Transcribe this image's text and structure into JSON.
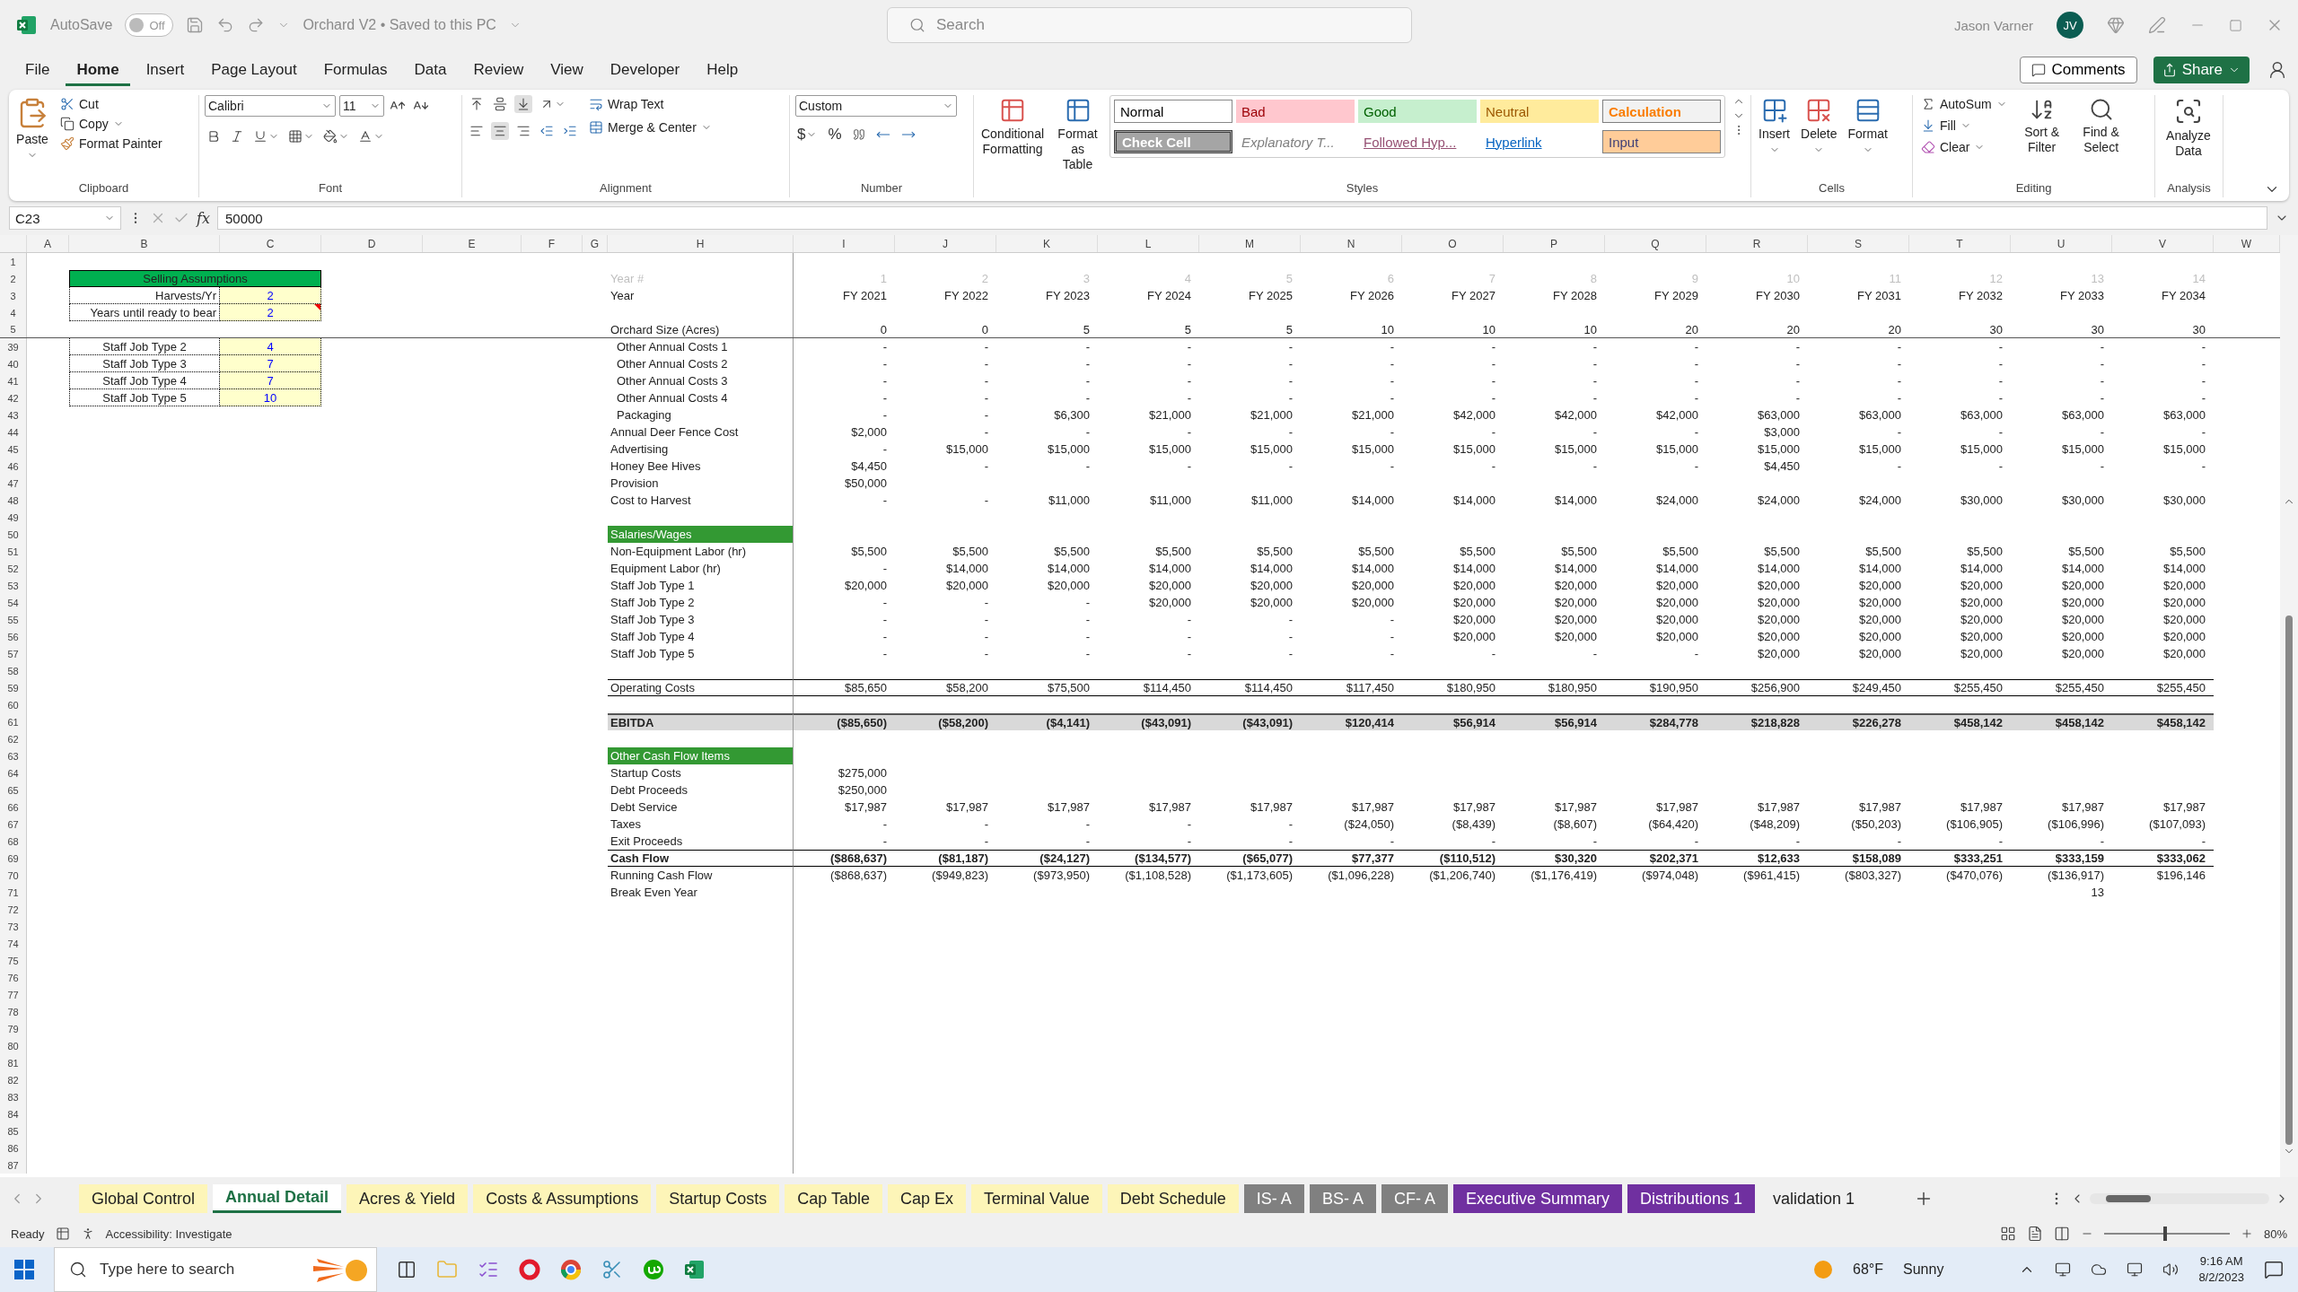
{
  "title_bar": {
    "autosave_label": "AutoSave",
    "autosave": {
      "on": false,
      "label": "Off"
    },
    "document": "Orchard V2 • Saved to this PC",
    "search_placeholder": "Search",
    "user": "Jason Varner",
    "avatar": "JV"
  },
  "menu_tabs": [
    {
      "label": "File",
      "selected": false
    },
    {
      "label": "Home",
      "selected": true
    },
    {
      "label": "Insert",
      "selected": false
    },
    {
      "label": "Page Layout",
      "selected": false
    },
    {
      "label": "Formulas",
      "selected": false
    },
    {
      "label": "Data",
      "selected": false
    },
    {
      "label": "Review",
      "selected": false
    },
    {
      "label": "View",
      "selected": false
    },
    {
      "label": "Developer",
      "selected": false
    },
    {
      "label": "Help",
      "selected": false
    }
  ],
  "comments": "Comments",
  "share": "Share",
  "ribbon": {
    "clipboard": {
      "paste": "Paste",
      "cut": "Cut",
      "copy": "Copy",
      "format_painter": "Format Painter",
      "label": "Clipboard"
    },
    "font": {
      "name": "Calibri",
      "size": "11",
      "label": "Font"
    },
    "alignment": {
      "wrap": "Wrap Text",
      "merge": "Merge & Center",
      "label": "Alignment"
    },
    "number": {
      "format": "Custom",
      "currency": "$",
      "percent": "%",
      "label": "Number"
    },
    "styles": {
      "conditional": "Conditional Formatting",
      "format_table": "Format as Table",
      "label": "Styles",
      "items": [
        {
          "label": "Normal",
          "kind": "normal"
        },
        {
          "label": "Bad",
          "kind": "bad"
        },
        {
          "label": "Good",
          "kind": "good"
        },
        {
          "label": "Neutral",
          "kind": "neutral"
        },
        {
          "label": "Calculation",
          "kind": "calculation"
        },
        {
          "label": "Check Cell",
          "kind": "check"
        },
        {
          "label": "Explanatory T...",
          "kind": "explanatory"
        },
        {
          "label": "Followed Hyp...",
          "kind": "followed"
        },
        {
          "label": "Hyperlink",
          "kind": "hyperlink"
        },
        {
          "label": "Input",
          "kind": "input"
        }
      ]
    },
    "cells": {
      "insert": "Insert",
      "delete": "Delete",
      "format": "Format",
      "label": "Cells"
    },
    "editing": {
      "autosum": "AutoSum",
      "fill": "Fill",
      "clear": "Clear",
      "sort": "Sort & Filter",
      "find": "Find & Select",
      "label": "Editing"
    },
    "analysis": {
      "analyze": "Analyze Data",
      "label": "Analysis"
    }
  },
  "formula_bar": {
    "name_box": "C23",
    "fx": "fx",
    "value": "50000"
  },
  "columns": [
    "A",
    "B",
    "C",
    "D",
    "E",
    "F",
    "G",
    "H",
    "I",
    "J",
    "K",
    "L",
    "M",
    "N",
    "O",
    "P",
    "Q",
    "R",
    "S",
    "T",
    "U",
    "V",
    "W"
  ],
  "rows": [
    {
      "n": "1",
      "kind": "plain"
    },
    {
      "n": "2",
      "kind": "year_num",
      "left": {
        "kind": "header",
        "label": "Selling Assumptions"
      },
      "h": "Year #",
      "values": [
        "1",
        "2",
        "3",
        "4",
        "5",
        "6",
        "7",
        "8",
        "9",
        "10",
        "11",
        "12",
        "13",
        "14"
      ]
    },
    {
      "n": "3",
      "kind": "plain",
      "left": {
        "kind": "setting",
        "label": "Harvests/Yr",
        "value": "2",
        "comment": false
      },
      "h": "Year",
      "values": [
        "FY 2021",
        "FY 2022",
        "FY 2023",
        "FY 2024",
        "FY 2025",
        "FY 2026",
        "FY 2027",
        "FY 2028",
        "FY 2029",
        "FY 2030",
        "FY 2031",
        "FY 2032",
        "FY 2033",
        "FY 2034"
      ]
    },
    {
      "n": "4",
      "kind": "plain",
      "left": {
        "kind": "setting",
        "label": "Years until ready to bear",
        "value": "2",
        "comment": true
      }
    },
    {
      "n": "5",
      "kind": "frozen",
      "h": "Orchard Size (Acres)",
      "values": [
        "0",
        "0",
        "5",
        "5",
        "5",
        "10",
        "10",
        "10",
        "20",
        "20",
        "20",
        "30",
        "30",
        "30"
      ]
    },
    {
      "n": "39",
      "kind": "sub",
      "left": {
        "kind": "staff",
        "label": "Staff Job Type 2",
        "value": "4",
        "comment": false
      },
      "h": "Other Annual Costs 1",
      "values": [
        "-",
        "-",
        "-",
        "-",
        "-",
        "-",
        "-",
        "-",
        "-",
        "-",
        "-",
        "-",
        "-",
        "-"
      ]
    },
    {
      "n": "40",
      "kind": "sub",
      "left": {
        "kind": "staff",
        "label": "Staff Job Type 3",
        "value": "7",
        "comment": false
      },
      "h": "Other Annual Costs 2",
      "values": [
        "-",
        "-",
        "-",
        "-",
        "-",
        "-",
        "-",
        "-",
        "-",
        "-",
        "-",
        "-",
        "-",
        "-"
      ]
    },
    {
      "n": "41",
      "kind": "sub",
      "left": {
        "kind": "staff",
        "label": "Staff Job Type 4",
        "value": "7",
        "comment": false
      },
      "h": "Other Annual Costs 3",
      "values": [
        "-",
        "-",
        "-",
        "-",
        "-",
        "-",
        "-",
        "-",
        "-",
        "-",
        "-",
        "-",
        "-",
        "-"
      ]
    },
    {
      "n": "42",
      "kind": "sub",
      "left": {
        "kind": "staff",
        "label": "Staff Job Type 5",
        "value": "10",
        "comment": false
      },
      "h": "Other Annual Costs 4",
      "values": [
        "-",
        "-",
        "-",
        "-",
        "-",
        "-",
        "-",
        "-",
        "-",
        "-",
        "-",
        "-",
        "-",
        "-"
      ]
    },
    {
      "n": "43",
      "kind": "sub",
      "h": "Packaging",
      "values": [
        "-",
        "-",
        "$6,300",
        "$21,000",
        "$21,000",
        "$21,000",
        "$42,000",
        "$42,000",
        "$42,000",
        "$63,000",
        "$63,000",
        "$63,000",
        "$63,000",
        "$63,000"
      ]
    },
    {
      "n": "44",
      "kind": "plain",
      "h": "Annual Deer Fence Cost",
      "values": [
        "$2,000",
        "-",
        "-",
        "-",
        "-",
        "-",
        "-",
        "-",
        "-",
        "$3,000",
        "-",
        "-",
        "-",
        "-"
      ]
    },
    {
      "n": "45",
      "kind": "plain",
      "h": "Advertising",
      "values": [
        "-",
        "$15,000",
        "$15,000",
        "$15,000",
        "$15,000",
        "$15,000",
        "$15,000",
        "$15,000",
        "$15,000",
        "$15,000",
        "$15,000",
        "$15,000",
        "$15,000",
        "$15,000"
      ]
    },
    {
      "n": "46",
      "kind": "plain",
      "h": "Honey Bee Hives",
      "values": [
        "$4,450",
        "-",
        "-",
        "-",
        "-",
        "-",
        "-",
        "-",
        "-",
        "$4,450",
        "-",
        "-",
        "-",
        "-"
      ]
    },
    {
      "n": "47",
      "kind": "plain",
      "h": "Provision",
      "values": [
        "$50,000"
      ]
    },
    {
      "n": "48",
      "kind": "plain",
      "h": "Cost to Harvest",
      "values": [
        "-",
        "-",
        "$11,000",
        "$11,000",
        "$11,000",
        "$14,000",
        "$14,000",
        "$14,000",
        "$24,000",
        "$24,000",
        "$24,000",
        "$30,000",
        "$30,000",
        "$30,000"
      ]
    },
    {
      "n": "49",
      "kind": "plain"
    },
    {
      "n": "50",
      "kind": "section",
      "h": "Salaries/Wages"
    },
    {
      "n": "51",
      "kind": "plain",
      "h": "Non-Equipment Labor (hr)",
      "values": [
        "$5,500",
        "$5,500",
        "$5,500",
        "$5,500",
        "$5,500",
        "$5,500",
        "$5,500",
        "$5,500",
        "$5,500",
        "$5,500",
        "$5,500",
        "$5,500",
        "$5,500",
        "$5,500"
      ]
    },
    {
      "n": "52",
      "kind": "plain",
      "h": "Equipment Labor (hr)",
      "values": [
        "-",
        "$14,000",
        "$14,000",
        "$14,000",
        "$14,000",
        "$14,000",
        "$14,000",
        "$14,000",
        "$14,000",
        "$14,000",
        "$14,000",
        "$14,000",
        "$14,000",
        "$14,000"
      ]
    },
    {
      "n": "53",
      "kind": "plain",
      "h": "Staff Job Type 1",
      "values": [
        "$20,000",
        "$20,000",
        "$20,000",
        "$20,000",
        "$20,000",
        "$20,000",
        "$20,000",
        "$20,000",
        "$20,000",
        "$20,000",
        "$20,000",
        "$20,000",
        "$20,000",
        "$20,000"
      ]
    },
    {
      "n": "54",
      "kind": "plain",
      "h": "Staff Job Type 2",
      "values": [
        "-",
        "-",
        "-",
        "$20,000",
        "$20,000",
        "$20,000",
        "$20,000",
        "$20,000",
        "$20,000",
        "$20,000",
        "$20,000",
        "$20,000",
        "$20,000",
        "$20,000"
      ]
    },
    {
      "n": "55",
      "kind": "plain",
      "h": "Staff Job Type 3",
      "values": [
        "-",
        "-",
        "-",
        "-",
        "-",
        "-",
        "$20,000",
        "$20,000",
        "$20,000",
        "$20,000",
        "$20,000",
        "$20,000",
        "$20,000",
        "$20,000"
      ]
    },
    {
      "n": "56",
      "kind": "plain",
      "h": "Staff Job Type 4",
      "values": [
        "-",
        "-",
        "-",
        "-",
        "-",
        "-",
        "$20,000",
        "$20,000",
        "$20,000",
        "$20,000",
        "$20,000",
        "$20,000",
        "$20,000",
        "$20,000"
      ]
    },
    {
      "n": "57",
      "kind": "plain",
      "h": "Staff Job Type 5",
      "values": [
        "-",
        "-",
        "-",
        "-",
        "-",
        "-",
        "-",
        "-",
        "-",
        "$20,000",
        "$20,000",
        "$20,000",
        "$20,000",
        "$20,000"
      ]
    },
    {
      "n": "58",
      "kind": "plain"
    },
    {
      "n": "59",
      "kind": "total",
      "h": "Operating Costs",
      "values": [
        "$85,650",
        "$58,200",
        "$75,500",
        "$114,450",
        "$114,450",
        "$117,450",
        "$180,950",
        "$180,950",
        "$190,950",
        "$256,900",
        "$249,450",
        "$255,450",
        "$255,450",
        "$255,450"
      ]
    },
    {
      "n": "60",
      "kind": "plain"
    },
    {
      "n": "61",
      "kind": "ebitda",
      "h": "EBITDA",
      "values": [
        "($85,650)",
        "($58,200)",
        "($4,141)",
        "($43,091)",
        "($43,091)",
        "$120,414",
        "$56,914",
        "$56,914",
        "$284,778",
        "$218,828",
        "$226,278",
        "$458,142",
        "$458,142",
        "$458,142"
      ]
    },
    {
      "n": "62",
      "kind": "plain"
    },
    {
      "n": "63",
      "kind": "section",
      "h": "Other Cash Flow Items"
    },
    {
      "n": "64",
      "kind": "plain",
      "h": "Startup Costs",
      "values": [
        "$275,000"
      ]
    },
    {
      "n": "65",
      "kind": "plain",
      "h": "Debt Proceeds",
      "values": [
        "$250,000"
      ]
    },
    {
      "n": "66",
      "kind": "plain",
      "h": "Debt Service",
      "values": [
        "$17,987",
        "$17,987",
        "$17,987",
        "$17,987",
        "$17,987",
        "$17,987",
        "$17,987",
        "$17,987",
        "$17,987",
        "$17,987",
        "$17,987",
        "$17,987",
        "$17,987",
        "$17,987"
      ]
    },
    {
      "n": "67",
      "kind": "plain",
      "h": "Taxes",
      "values": [
        "-",
        "-",
        "-",
        "-",
        "-",
        "($24,050)",
        "($8,439)",
        "($8,607)",
        "($64,420)",
        "($48,209)",
        "($50,203)",
        "($106,905)",
        "($106,996)",
        "($107,093)"
      ]
    },
    {
      "n": "68",
      "kind": "plain",
      "h": "Exit Proceeds",
      "values": [
        "-",
        "-",
        "-",
        "-",
        "-",
        "-",
        "-",
        "-",
        "-",
        "-",
        "-",
        "-",
        "-",
        "-"
      ]
    },
    {
      "n": "69",
      "kind": "cashflow",
      "h": "Cash Flow",
      "values": [
        "($868,637)",
        "($81,187)",
        "($24,127)",
        "($134,577)",
        "($65,077)",
        "$77,377",
        "($110,512)",
        "$30,320",
        "$202,371",
        "$12,633",
        "$158,089",
        "$333,251",
        "$333,159",
        "$333,062"
      ]
    },
    {
      "n": "70",
      "kind": "plain",
      "h": "Running Cash Flow",
      "values": [
        "($868,637)",
        "($949,823)",
        "($973,950)",
        "($1,108,528)",
        "($1,173,605)",
        "($1,096,228)",
        "($1,206,740)",
        "($1,176,419)",
        "($974,048)",
        "($961,415)",
        "($803,327)",
        "($470,076)",
        "($136,917)",
        "$196,146"
      ]
    },
    {
      "n": "71",
      "kind": "break_even",
      "h": "Break Even Year",
      "result": "13"
    },
    {
      "n": "72",
      "kind": "plain"
    },
    {
      "n": "73",
      "kind": "plain"
    },
    {
      "n": "74",
      "kind": "plain"
    },
    {
      "n": "75",
      "kind": "plain"
    },
    {
      "n": "76",
      "kind": "plain"
    },
    {
      "n": "77",
      "kind": "plain"
    },
    {
      "n": "78",
      "kind": "plain"
    },
    {
      "n": "79",
      "kind": "plain"
    },
    {
      "n": "80",
      "kind": "plain"
    },
    {
      "n": "81",
      "kind": "plain"
    },
    {
      "n": "82",
      "kind": "plain"
    },
    {
      "n": "83",
      "kind": "plain"
    },
    {
      "n": "84",
      "kind": "plain"
    },
    {
      "n": "85",
      "kind": "plain"
    },
    {
      "n": "86",
      "kind": "plain"
    },
    {
      "n": "87",
      "kind": "plain"
    }
  ],
  "sheet_tabs": [
    {
      "label": "Global Control",
      "selected": false,
      "color": "#fdf5b8"
    },
    {
      "label": "Annual Detail",
      "selected": true
    },
    {
      "label": "Acres & Yield",
      "selected": false,
      "color": "#fdf5b8"
    },
    {
      "label": "Costs & Assumptions",
      "selected": false,
      "color": "#fdf5b8"
    },
    {
      "label": "Startup Costs",
      "selected": false,
      "color": "#fdf5b8"
    },
    {
      "label": "Cap Table",
      "selected": false,
      "color": "#fdf5b8"
    },
    {
      "label": "Cap Ex",
      "selected": false,
      "color": "#fdf5b8"
    },
    {
      "label": "Terminal Value",
      "selected": false,
      "color": "#fdf5b8"
    },
    {
      "label": "Debt Schedule",
      "selected": false,
      "color": "#fdf5b8"
    },
    {
      "label": "IS- A",
      "selected": false,
      "color": "#808080"
    },
    {
      "label": "BS- A",
      "selected": false,
      "color": "#808080"
    },
    {
      "label": "CF- A",
      "selected": false,
      "color": "#808080"
    },
    {
      "label": "Executive Summary",
      "selected": false,
      "color": "#7030a0"
    },
    {
      "label": "Distributions 1",
      "selected": false,
      "color": "#7030a0"
    },
    {
      "label": "validation 1",
      "selected": false
    }
  ],
  "status_bar": {
    "mode": "Ready",
    "accessibility": "Accessibility: Investigate",
    "zoom": {
      "level": 0.47,
      "reading": "80%"
    }
  },
  "taskbar": {
    "search_placeholder": "Type here to search",
    "temperature": "68°F",
    "weather": "Sunny",
    "time": "9:16 AM",
    "date": "8/2/2023"
  }
}
